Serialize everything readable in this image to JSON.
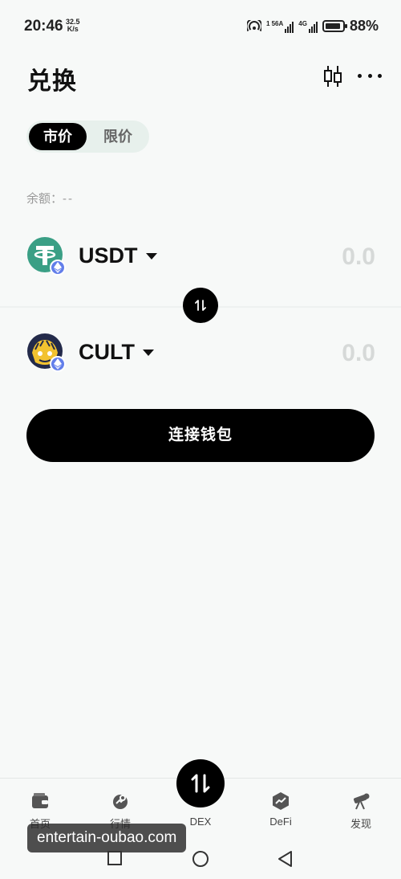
{
  "status_bar": {
    "time": "20:46",
    "net_speed_value": "32.5",
    "net_speed_unit": "K/s",
    "sim1_label": "1 56A",
    "sim2_label": "4G",
    "battery": "88%"
  },
  "header": {
    "title": "兑换"
  },
  "mode_tabs": {
    "market": "市价",
    "limit": "限价",
    "selected": "market"
  },
  "balance": {
    "label": "余额：",
    "value": "--"
  },
  "from_token": {
    "symbol": "USDT",
    "amount": "0.0",
    "icon": "tether-icon",
    "chain_icon": "ethereum-icon",
    "color": "#3a9f85"
  },
  "to_token": {
    "symbol": "CULT",
    "amount": "0.0",
    "icon": "cult-icon",
    "chain_icon": "ethereum-icon"
  },
  "connect_wallet_label": "连接钱包",
  "bottom_nav": {
    "items": [
      {
        "label": "首页",
        "icon": "wallet-icon"
      },
      {
        "label": "行情",
        "icon": "market-icon"
      },
      {
        "label": "DEX",
        "icon": "swap-icon"
      },
      {
        "label": "DeFi",
        "icon": "defi-icon"
      },
      {
        "label": "发现",
        "icon": "telescope-icon"
      }
    ]
  },
  "watermark": "entertain-oubao.com",
  "colors": {
    "background": "#f7f9f8",
    "primary": "#000000",
    "muted_amount": "#d6d9d8",
    "eth_badge": "#627eea"
  }
}
